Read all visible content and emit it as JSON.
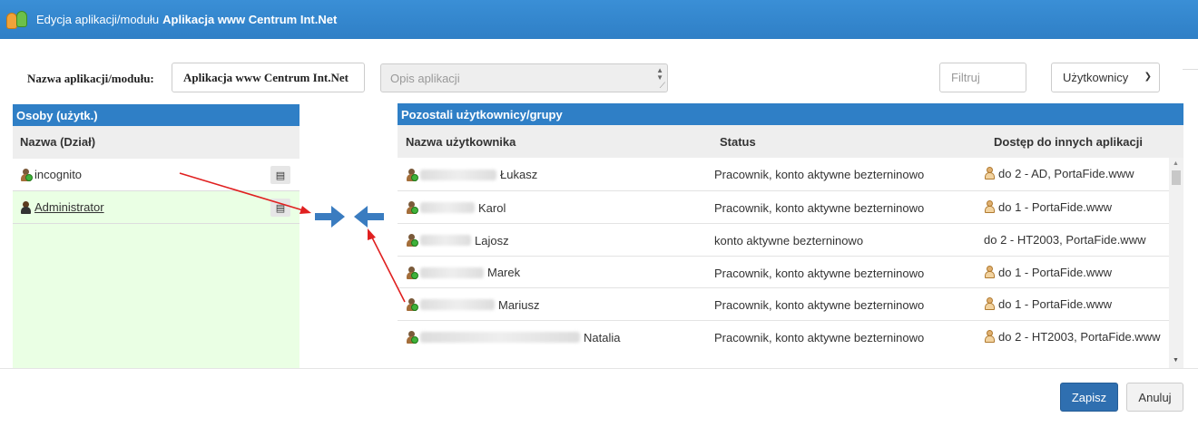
{
  "window": {
    "title_prefix": "Edycja aplikacji/modułu",
    "title_name": "Aplikacja www Centrum Int.Net",
    "icon": "users-icon"
  },
  "form": {
    "name_label": "Nazwa aplikacji/modułu:",
    "name_value": "Aplikacja www Centrum Int.Net",
    "description_placeholder": "Opis aplikacji",
    "filter_placeholder": "Filtruj",
    "type_selected": "Użytkownicy"
  },
  "left_panel": {
    "title": "Osoby (użytk.)",
    "column": "Nazwa (Dział)",
    "rows": [
      {
        "label": "incognito",
        "icon": "user-group-icon",
        "selected": false
      },
      {
        "label": "Administrator",
        "icon": "user-icon",
        "selected": true
      }
    ]
  },
  "transfer": {
    "add_icon": "arrow-right-icon",
    "remove_icon": "arrow-left-icon"
  },
  "right_panel": {
    "title": "Pozostali użytkownicy/grupy",
    "columns": [
      "Nazwa użytkownika",
      "Status",
      "Dostęp do innych aplikacji"
    ],
    "rows": [
      {
        "name": "Łukasz",
        "status": "Pracownik, konto aktywne bezterninowo",
        "access": "do 2 - AD, PortaFide.www",
        "access_icon": true
      },
      {
        "name": "Karol",
        "status": "Pracownik, konto aktywne bezterninowo",
        "access": "do 1 - PortaFide.www",
        "access_icon": true
      },
      {
        "name": "Lajosz",
        "status": "konto aktywne bezterninowo",
        "access": "do 2 - HT2003, PortaFide.www",
        "access_icon": false
      },
      {
        "name": "Marek",
        "status": "Pracownik, konto aktywne bezterninowo",
        "access": "do 1 - PortaFide.www",
        "access_icon": true
      },
      {
        "name": "Mariusz",
        "status": "Pracownik, konto aktywne bezterninowo",
        "access": "do 1 - PortaFide.www",
        "access_icon": true
      },
      {
        "name": "Natalia",
        "status": "Pracownik, konto aktywne bezterninowo",
        "access": "do 2 - HT2003, PortaFide.www",
        "access_icon": true
      }
    ]
  },
  "footer": {
    "save_label": "Zapisz",
    "cancel_label": "Anuluj"
  },
  "colors": {
    "header_blue": "#2f7fc6",
    "selected_row": "#eaffe4",
    "annotation_red": "#e02020",
    "primary_button": "#2f6fb0"
  }
}
